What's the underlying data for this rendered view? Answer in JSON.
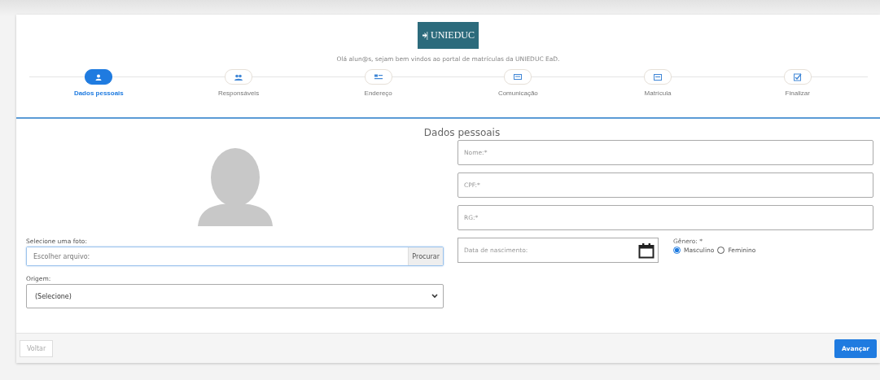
{
  "header": {
    "logo": "UNIEDUC",
    "welcome": "Olá alun@s, sejam bem vindos ao portal de matrículas da UNIEDUC EaD."
  },
  "steps": [
    {
      "label": "Dados pessoais",
      "kind": "person",
      "selected": true
    },
    {
      "label": "Responsáveis",
      "kind": "group",
      "selected": false
    },
    {
      "label": "Endereço",
      "kind": "card",
      "selected": false
    },
    {
      "label": "Comunicação",
      "kind": "message",
      "selected": false
    },
    {
      "label": "Matrícula",
      "kind": "id",
      "selected": false
    },
    {
      "label": "Finalizar",
      "kind": "check",
      "selected": false
    }
  ],
  "section_title": "Dados pessoais",
  "photo": {
    "label": "Selecione uma foto:",
    "placeholder": "Escolher arquivo:",
    "button": "Procurar"
  },
  "origin": {
    "label": "Origem:",
    "value": "(Selecione)"
  },
  "fields": [
    {
      "placeholder": "Nome:*"
    },
    {
      "placeholder": "CPF:*"
    },
    {
      "placeholder": "RG:*"
    }
  ],
  "birth": {
    "placeholder": "Data de nascimento:"
  },
  "gender": {
    "label": "Gênero: *",
    "options": [
      {
        "label": "Masculino",
        "selected": true
      },
      {
        "label": "Feminino",
        "selected": false
      }
    ]
  },
  "footer": {
    "back": "Voltar",
    "next": "Avançar"
  }
}
